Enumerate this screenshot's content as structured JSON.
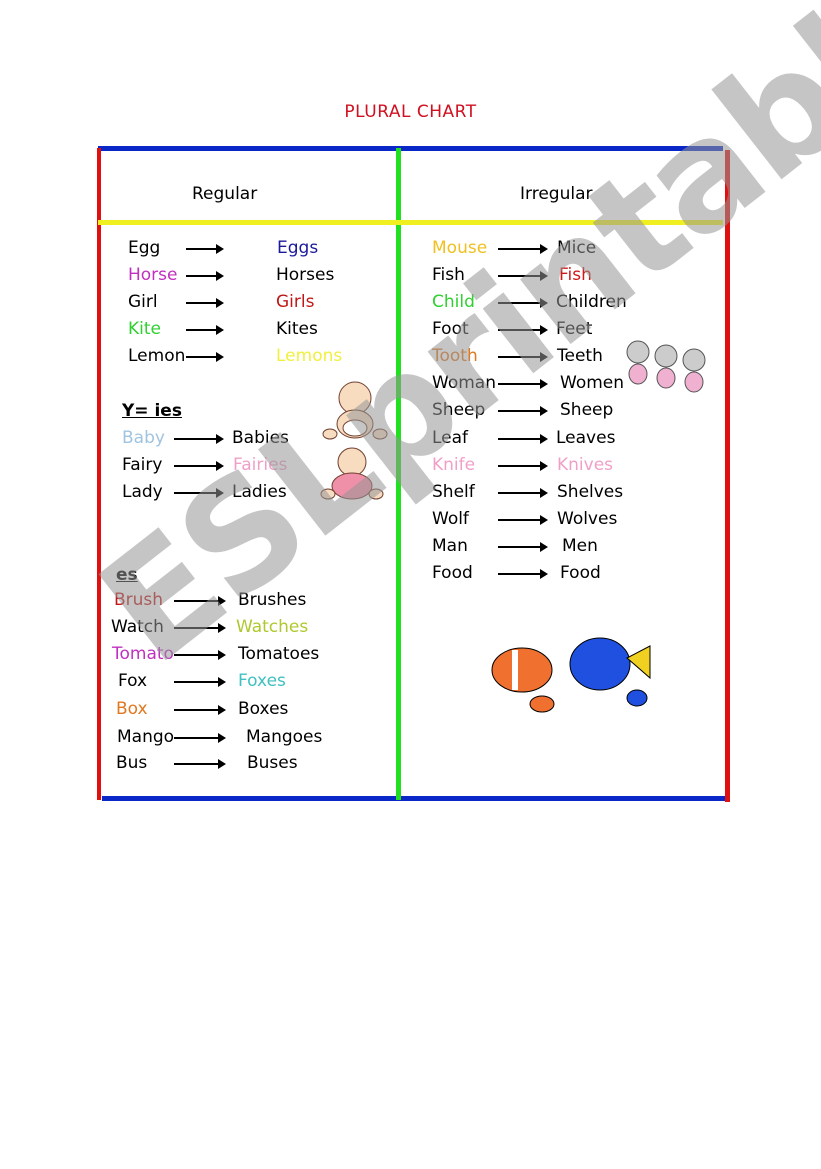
{
  "title": "PLURAL CHART",
  "headers": {
    "regular": "Regular",
    "irregular": "Irregular"
  },
  "regular": {
    "basic": [
      {
        "singular": "Egg",
        "s_color": "#000000",
        "plural": "Eggs",
        "p_color": "#1a1a9a"
      },
      {
        "singular": "Horse",
        "s_color": "#c030c0",
        "plural": "Horses",
        "p_color": "#000000"
      },
      {
        "singular": "Girl",
        "s_color": "#000000",
        "plural": "Girls",
        "p_color": "#c01818"
      },
      {
        "singular": "Kite",
        "s_color": "#30d030",
        "plural": "Kites",
        "p_color": "#000000"
      },
      {
        "singular": "Lemon",
        "s_color": "#000000",
        "plural": "Lemons",
        "p_color": "#f0f040"
      }
    ],
    "ies_heading": "Y= ies",
    "ies": [
      {
        "singular": "Baby",
        "s_color": "#a0c4e0",
        "plural": "Babies",
        "p_color": "#000000"
      },
      {
        "singular": "Fairy",
        "s_color": "#000000",
        "plural": "Fairies",
        "p_color": "#f0a0c8"
      },
      {
        "singular": "Lady",
        "s_color": "#000000",
        "plural": "Ladies",
        "p_color": "#000000"
      }
    ],
    "es_heading": "es",
    "es": [
      {
        "singular": "Brush",
        "s_color": "#c01818",
        "plural": "Brushes",
        "p_color": "#000000"
      },
      {
        "singular": "Watch",
        "s_color": "#000000",
        "plural": "Watches",
        "p_color": "#b0c830"
      },
      {
        "singular": "Tomato",
        "s_color": "#c030c0",
        "plural": "Tomatoes",
        "p_color": "#000000"
      },
      {
        "singular": "Fox",
        "s_color": "#000000",
        "plural": "Foxes",
        "p_color": "#40c0c0"
      },
      {
        "singular": "Box",
        "s_color": "#e07820",
        "plural": "Boxes",
        "p_color": "#000000"
      },
      {
        "singular": "Mango",
        "s_color": "#000000",
        "plural": "Mangoes",
        "p_color": "#000000"
      },
      {
        "singular": "Bus",
        "s_color": "#000000",
        "plural": "Buses",
        "p_color": "#000000"
      }
    ]
  },
  "irregular": [
    {
      "singular": "Mouse",
      "s_color": "#f0c020",
      "plural": "Mice",
      "p_color": "#000000"
    },
    {
      "singular": "Fish",
      "s_color": "#000000",
      "plural": "Fish",
      "p_color": "#d01818"
    },
    {
      "singular": "Child",
      "s_color": "#30d030",
      "plural": "Children",
      "p_color": "#000000"
    },
    {
      "singular": "Foot",
      "s_color": "#000000",
      "plural": "Feet",
      "p_color": "#000000"
    },
    {
      "singular": "Tooth",
      "s_color": "#e07820",
      "plural": "Teeth",
      "p_color": "#000000"
    },
    {
      "singular": "Woman",
      "s_color": "#000000",
      "plural": "Women",
      "p_color": "#000000"
    },
    {
      "singular": "Sheep",
      "s_color": "#000000",
      "plural": "Sheep",
      "p_color": "#000000"
    },
    {
      "singular": "Leaf",
      "s_color": "#000000",
      "plural": "Leaves",
      "p_color": "#000000"
    },
    {
      "singular": "Knife",
      "s_color": "#f0a0c8",
      "plural": "Knives",
      "p_color": "#f0a0c8"
    },
    {
      "singular": "Shelf",
      "s_color": "#000000",
      "plural": "Shelves",
      "p_color": "#000000"
    },
    {
      "singular": "Wolf",
      "s_color": "#000000",
      "plural": "Wolves",
      "p_color": "#000000"
    },
    {
      "singular": "Man",
      "s_color": "#000000",
      "plural": "Men",
      "p_color": "#000000"
    },
    {
      "singular": "Food",
      "s_color": "#000000",
      "plural": "Food",
      "p_color": "#000000"
    }
  ],
  "watermark": "ESLprintables.com",
  "border_colors": {
    "top": "#0a28c8",
    "side": "#e01010",
    "divider": "#20e020",
    "header_rule": "#f0f020"
  }
}
